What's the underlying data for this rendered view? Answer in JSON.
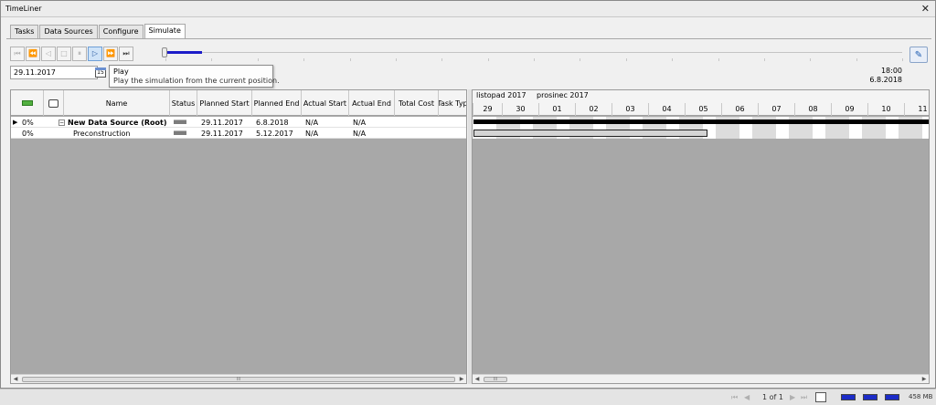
{
  "window": {
    "title": "TimeLiner",
    "close_glyph": "✕"
  },
  "tabs": [
    {
      "label": "Tasks",
      "active": false
    },
    {
      "label": "Data Sources",
      "active": false
    },
    {
      "label": "Configure",
      "active": false
    },
    {
      "label": "Simulate",
      "active": true
    }
  ],
  "toolbar": {
    "buttons": [
      {
        "name": "rewind-to-start-button",
        "icon": "skip-back-icon",
        "glyph": "⏮"
      },
      {
        "name": "step-back-button",
        "icon": "step-back-icon",
        "glyph": "⏪"
      },
      {
        "name": "play-reverse-button",
        "icon": "play-reverse-icon",
        "glyph": "◁"
      },
      {
        "name": "stop-button",
        "icon": "stop-icon",
        "glyph": "□"
      },
      {
        "name": "pause-button",
        "icon": "pause-icon",
        "glyph": "⏸"
      },
      {
        "name": "play-button",
        "icon": "play-icon",
        "glyph": "▷"
      },
      {
        "name": "step-forward-button",
        "icon": "step-forward-icon",
        "glyph": "⏩"
      },
      {
        "name": "forward-to-end-button",
        "icon": "skip-forward-icon",
        "glyph": "⏭"
      }
    ],
    "settings_glyph": "✎",
    "timeline_progress": 0.05
  },
  "date_input": {
    "value": "29.11.2017",
    "calendar_label": "15"
  },
  "tooltip": {
    "title": "Play",
    "text": "Play the simulation from the current position."
  },
  "time_readout": {
    "time": "18:00",
    "date": "6.8.2018"
  },
  "grid": {
    "columns": [
      {
        "key": "active",
        "label": ""
      },
      {
        "key": "comment",
        "label": ""
      },
      {
        "key": "name",
        "label": "Name"
      },
      {
        "key": "status",
        "label": "Status"
      },
      {
        "key": "planned_start",
        "label": "Planned Start"
      },
      {
        "key": "planned_end",
        "label": "Planned End"
      },
      {
        "key": "actual_start",
        "label": "Actual Start"
      },
      {
        "key": "actual_end",
        "label": "Actual End"
      },
      {
        "key": "total_cost",
        "label": "Total Cost"
      },
      {
        "key": "task_type",
        "label": "Task Typ"
      }
    ],
    "rows": [
      {
        "progress": "0%",
        "name": "New Data Source (Root)",
        "expander": "−",
        "planned_start": "29.11.2017",
        "planned_end": "6.8.2018",
        "actual_start": "N/A",
        "actual_end": "N/A"
      },
      {
        "progress": "0%",
        "name": "Preconstruction",
        "planned_start": "29.11.2017",
        "planned_end": "5.12.2017",
        "actual_start": "N/A",
        "actual_end": "N/A"
      }
    ],
    "scroll_thumb_glyph": "III"
  },
  "gantt": {
    "months": [
      "listopad 2017",
      "prosinec 2017"
    ],
    "days": [
      "29",
      "30",
      "01",
      "02",
      "03",
      "04",
      "05",
      "06",
      "07",
      "08",
      "09",
      "10",
      "11"
    ],
    "scroll_thumb_glyph": "III"
  },
  "statusbar": {
    "nav_first": "⏮",
    "nav_prev": "◀",
    "page": "1 of 1",
    "nav_next": "▶",
    "nav_last": "⏭",
    "memory": "458 MB"
  }
}
